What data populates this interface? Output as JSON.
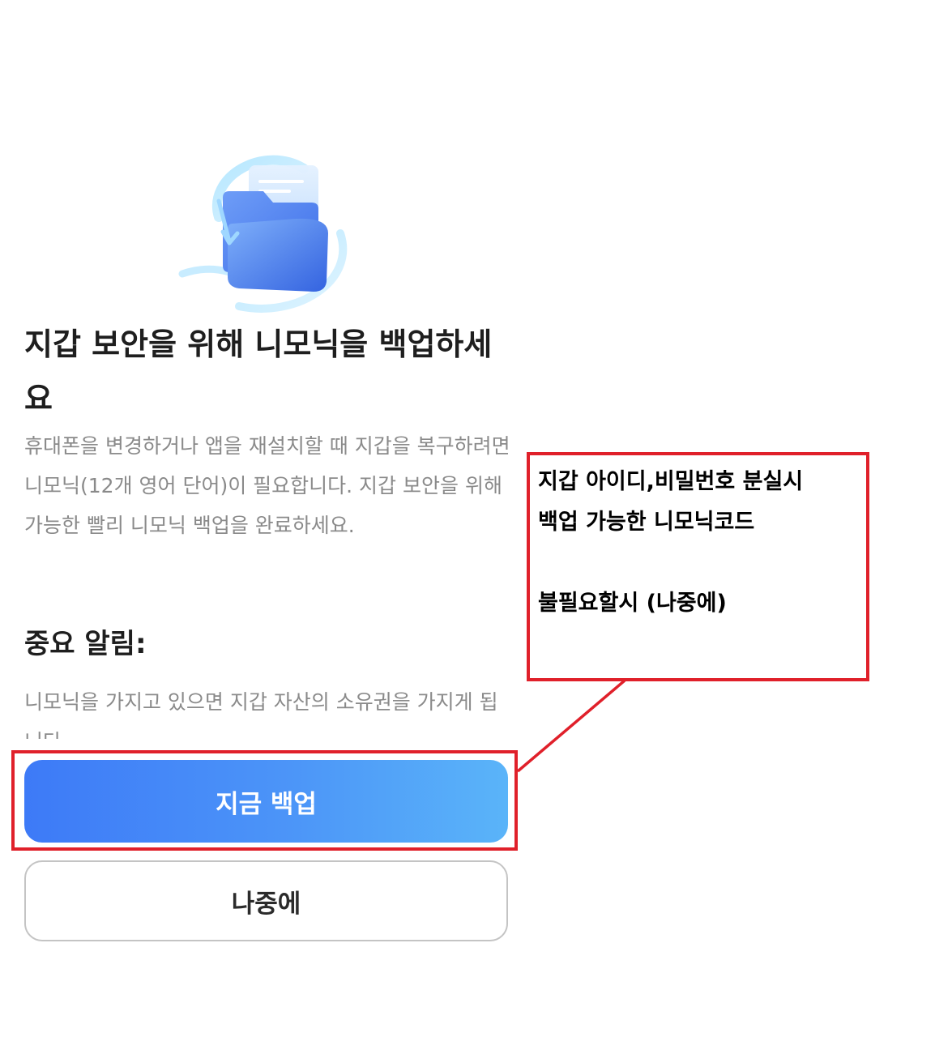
{
  "screen": {
    "title": "지갑 보안을 위해 니모닉을 백업하세요",
    "description": "휴대폰을 변경하거나 앱을 재설치할 때 지갑을 복구하려면 니모닉(12개 영어 단어)이 필요합니다. 지갑 보안을 위해 가능한 빨리 니모닉 백업을 완료하세요.",
    "notice_heading": "중요 알림:",
    "notice_text": "니모닉을 가지고 있으면 지갑 자산의 소유권을 가지게 됩니다",
    "illustration_icon": "folder-backup-icon"
  },
  "buttons": {
    "backup_now": "지금 백업",
    "later": "나중에"
  },
  "annotation": {
    "line1": "지갑 아이디,비밀번호 분실시",
    "line2": "백업 가능한 니모닉코드",
    "line3": "불필요할시 (나중에)",
    "border_color": "#e0202a"
  },
  "colors": {
    "primary_gradient_start": "#3d7af7",
    "primary_gradient_end": "#5ab4f9",
    "title_text": "#1e1e1e",
    "body_text": "#8a8a8a"
  }
}
